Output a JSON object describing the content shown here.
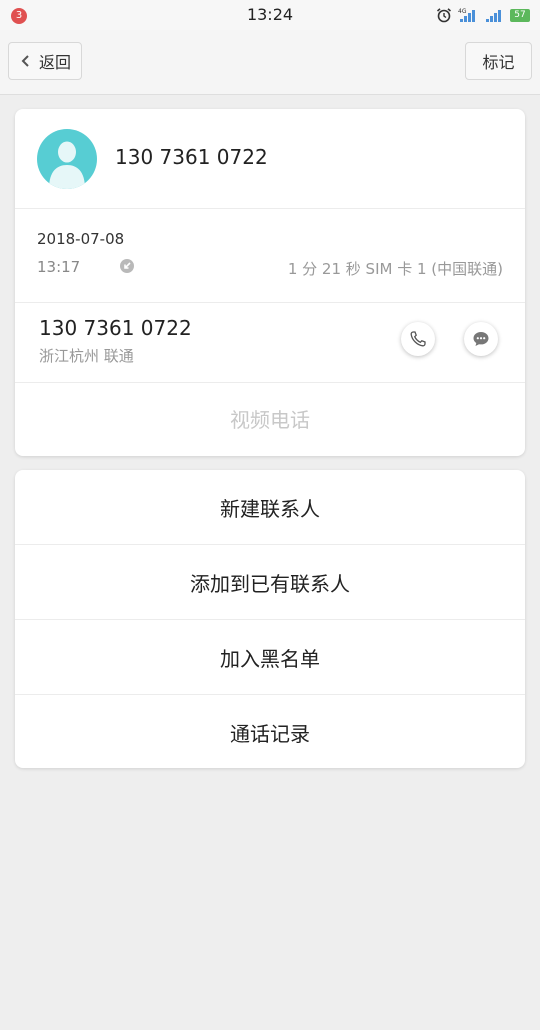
{
  "status_bar": {
    "notification_count": "3",
    "time": "13:24",
    "battery": "57",
    "icons": [
      "alarm-icon",
      "signal-4g-icon",
      "signal-icon",
      "battery-icon"
    ]
  },
  "header": {
    "back_label": "返回",
    "mark_label": "标记"
  },
  "contact": {
    "number": "130 7361 0722",
    "avatar_color": "#57cdd3"
  },
  "call_log": {
    "date": "2018-07-08",
    "time": "13:17",
    "duration": "1 分 21 秒 SIM 卡 1 (中国联通)"
  },
  "number_detail": {
    "number": "130 7361 0722",
    "location": "浙江杭州 联通"
  },
  "video_call_label": "视频电话",
  "actions": {
    "new_contact": "新建联系人",
    "add_existing": "添加到已有联系人",
    "blacklist": "加入黑名单",
    "call_history": "通话记录"
  }
}
